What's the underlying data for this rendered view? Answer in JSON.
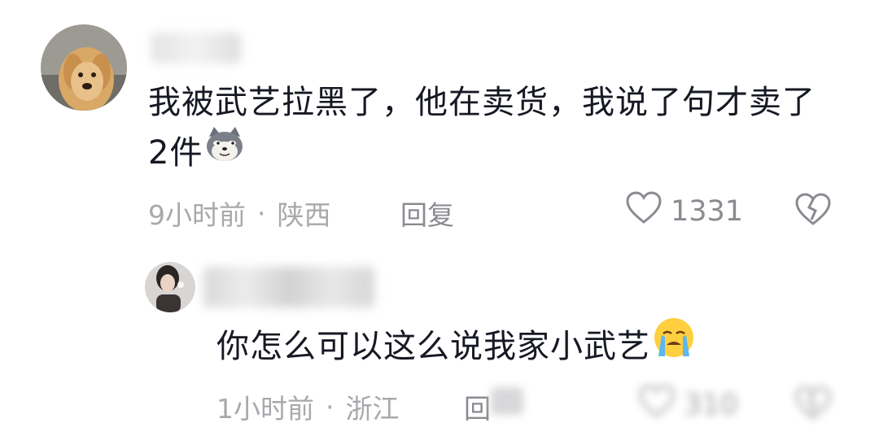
{
  "comments": [
    {
      "text": "我被武艺拉黑了，他在卖货，我说了句才卖了2件",
      "emoji": "doge-emoji",
      "time": "9小时前",
      "separator": "·",
      "location": "陕西",
      "reply_label": "回复",
      "likes": "1331"
    },
    {
      "text": "你怎么可以这么说我家小武艺",
      "emoji": "crying-face-emoji",
      "time": "1小时前",
      "separator": "·",
      "location": "浙江",
      "reply_label": "回复",
      "likes": "310"
    }
  ],
  "icons": {
    "like": "heart-outline-icon",
    "dislike": "broken-heart-icon"
  },
  "colors": {
    "text": "#161823",
    "meta": "#a8a9ad",
    "action": "#8a8b91"
  }
}
